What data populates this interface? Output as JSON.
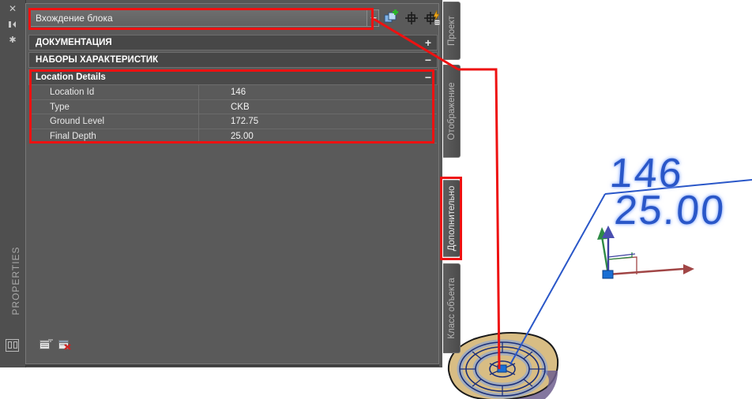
{
  "palette": {
    "title": "PROPERTIES",
    "edge_icons": [
      {
        "name": "close-icon",
        "glyph": "✕"
      },
      {
        "name": "auto-hide-icon",
        "glyph": "▶|"
      },
      {
        "name": "palette-settings-icon",
        "glyph": "✱"
      }
    ],
    "object_type": {
      "value": "Вхождение блока",
      "placeholder": "Вхождение блока"
    },
    "toolbar": [
      {
        "name": "add-property-set-definition-button",
        "tip": "Добавить"
      },
      {
        "name": "select-objects-button",
        "tip": "Выбор"
      },
      {
        "name": "quick-select-button",
        "tip": "Быстрый выбор"
      }
    ],
    "sections": [
      {
        "label": "ДОКУМЕНТАЦИЯ",
        "sign": "+",
        "expanded": false
      },
      {
        "label": "НАБОРЫ ХАРАКТЕРИСТИК",
        "sign": "−",
        "expanded": true
      },
      {
        "label": "Location Details",
        "sign": "−",
        "expanded": true
      }
    ],
    "properties": [
      {
        "label": "Location Id",
        "value": "146"
      },
      {
        "label": "Type",
        "value": "CKB"
      },
      {
        "label": "Ground Level",
        "value": "172.75"
      },
      {
        "label": "Final Depth",
        "value": "25.00"
      }
    ],
    "footer_buttons": [
      {
        "name": "add-property-set-button"
      },
      {
        "name": "remove-property-set-button"
      }
    ]
  },
  "side_tabs": [
    {
      "label": "Проект",
      "selected": false
    },
    {
      "label": "Отображение",
      "selected": false
    },
    {
      "label": "Дополнительно",
      "selected": true
    },
    {
      "label": "Класс объекта",
      "selected": false
    }
  ],
  "drawing": {
    "label_top": "146",
    "label_bottom": "25.00",
    "block_name": "borehole-block",
    "ucs_axes": [
      "X",
      "Y",
      "Z"
    ]
  },
  "colors": {
    "annotation_red": "#ee1111",
    "cad_blue": "#2a57c8",
    "panel_bg": "#5a5a5a",
    "header_bg": "#474747",
    "block_fill": "#d8bd84"
  }
}
